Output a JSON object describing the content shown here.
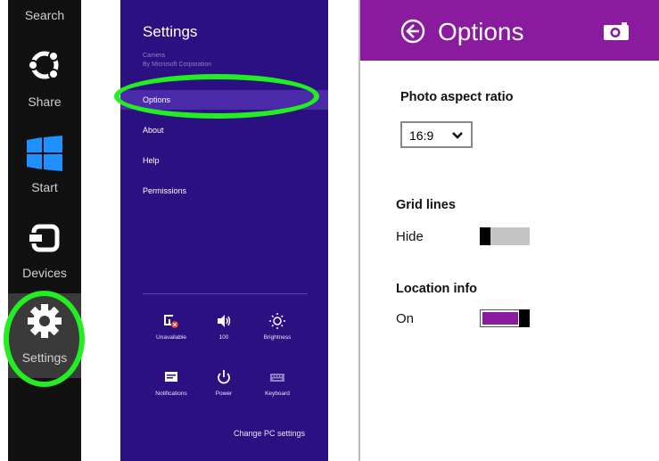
{
  "charms": {
    "search": "Search",
    "share": "Share",
    "start": "Start",
    "devices": "Devices",
    "settings": "Settings"
  },
  "settings_pane": {
    "title": "Settings",
    "subtitle_line1": "Camera",
    "subtitle_line2": "By Microsoft Corporation",
    "menu": [
      "Options",
      "About",
      "Help",
      "Permissions"
    ],
    "selected": "Options",
    "quick_settings": [
      {
        "label": "Unavailable",
        "icon": "network-unavailable-icon"
      },
      {
        "label": "100",
        "icon": "volume-icon"
      },
      {
        "label": "Brightness",
        "icon": "brightness-icon"
      },
      {
        "label": "Notifications",
        "icon": "notifications-icon"
      },
      {
        "label": "Power",
        "icon": "power-icon"
      },
      {
        "label": "Keyboard",
        "icon": "keyboard-icon"
      }
    ],
    "change_pc_settings": "Change PC settings"
  },
  "options_pane": {
    "title": "Options",
    "photo_aspect_ratio": {
      "label": "Photo aspect ratio",
      "value": "16:9"
    },
    "grid_lines": {
      "label": "Grid lines",
      "state_label": "Hide",
      "on": false
    },
    "location_info": {
      "label": "Location info",
      "state_label": "On",
      "on": true
    }
  },
  "colors": {
    "charms_bg": "#111111",
    "settings_pane_bg": "#2a1080",
    "options_header_bg": "#8a1a9e",
    "callout": "#22ee22"
  }
}
